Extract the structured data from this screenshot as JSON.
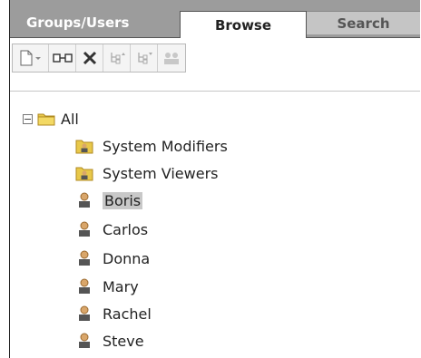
{
  "tabs": {
    "groups_users": "Groups/Users",
    "browse": "Browse",
    "search": "Search"
  },
  "toolbar": {
    "buttons": [
      {
        "icon": "new-document-icon",
        "label": "New",
        "enabled": true
      },
      {
        "icon": "link-icon",
        "label": "Link",
        "enabled": true
      },
      {
        "icon": "delete-icon",
        "label": "Delete",
        "enabled": true
      },
      {
        "icon": "move-up-icon",
        "label": "Move up",
        "enabled": false
      },
      {
        "icon": "move-down-icon",
        "label": "Move down",
        "enabled": false
      },
      {
        "icon": "users-icon",
        "label": "Users",
        "enabled": false
      }
    ]
  },
  "tree": {
    "root": {
      "label": "All",
      "expanded": true
    },
    "groups": [
      {
        "label": "System Modifiers"
      },
      {
        "label": "System Viewers"
      }
    ],
    "users": [
      {
        "label": "Boris",
        "selected": true
      },
      {
        "label": "Carlos"
      },
      {
        "label": "Donna"
      },
      {
        "label": "Mary"
      },
      {
        "label": "Rachel"
      },
      {
        "label": "Steve"
      }
    ]
  },
  "colors": {
    "tabbar": "#9c9c9c",
    "folder": "#e8c84a",
    "user_head": "#d9a66a",
    "user_body": "#555555",
    "selection": "#c8c8c8"
  }
}
